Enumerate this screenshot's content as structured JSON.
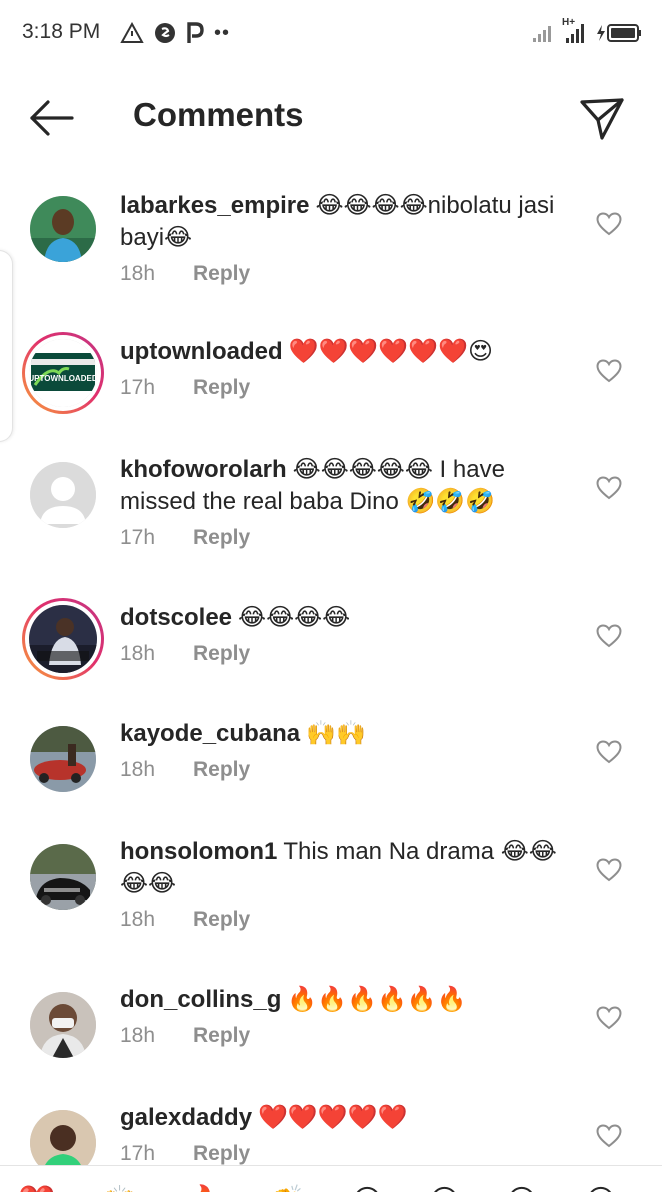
{
  "status_bar": {
    "time": "3:18 PM",
    "left_icons": [
      "warning-triangle-icon",
      "shazam-icon",
      "p-app-icon",
      "more-dots-icon"
    ],
    "right_icons": [
      "signal-icon",
      "hplus-signal-icon",
      "battery-charging-icon"
    ],
    "network": "H+"
  },
  "header": {
    "title": "Comments",
    "back_icon": "arrow-left-icon",
    "share_icon": "send-icon"
  },
  "comments": [
    {
      "username": "labarkes_empire",
      "text": "😂😂😂😂nibolatu jasi bayi😂",
      "time": "18h",
      "reply": "Reply",
      "ring": false,
      "avatar": "photo"
    },
    {
      "username": "uptownloaded",
      "text": "❤️❤️❤️❤️❤️❤️😍",
      "time": "17h",
      "reply": "Reply",
      "ring": true,
      "avatar": "logo",
      "avatar_logo_text": "UPTOWNLOADED"
    },
    {
      "username": "khofoworolarh",
      "text": "😂😂😂😂😂 I have missed the real baba Dino 🤣🤣🤣",
      "time": "17h",
      "reply": "Reply",
      "ring": false,
      "avatar": "default"
    },
    {
      "username": "dotscolee",
      "text": "😂😂😂😂",
      "time": "18h",
      "reply": "Reply",
      "ring": true,
      "avatar": "photo"
    },
    {
      "username": "kayode_cubana",
      "text": "🙌🙌",
      "time": "18h",
      "reply": "Reply",
      "ring": false,
      "avatar": "photo"
    },
    {
      "username": "honsolomon1",
      "text": "This man Na drama 😂😂😂😂",
      "time": "18h",
      "reply": "Reply",
      "ring": false,
      "avatar": "photo"
    },
    {
      "username": "don_collins_g",
      "text": "🔥🔥🔥🔥🔥🔥",
      "time": "18h",
      "reply": "Reply",
      "ring": false,
      "avatar": "photo"
    },
    {
      "username": "galexdaddy",
      "text": "❤️❤️❤️❤️❤️",
      "time": "17h",
      "reply": "Reply",
      "ring": false,
      "avatar": "photo"
    }
  ],
  "emoji_bar": [
    "❤️",
    "🙌",
    "🔥",
    "👏",
    "😢",
    "😍",
    "😮",
    "😂"
  ],
  "colors": {
    "text": "#262626",
    "secondary": "#8e8e8e",
    "story_ring_start": "#f9a13a",
    "story_ring_end": "#c13584",
    "like_outline": "#8e8e8e"
  }
}
